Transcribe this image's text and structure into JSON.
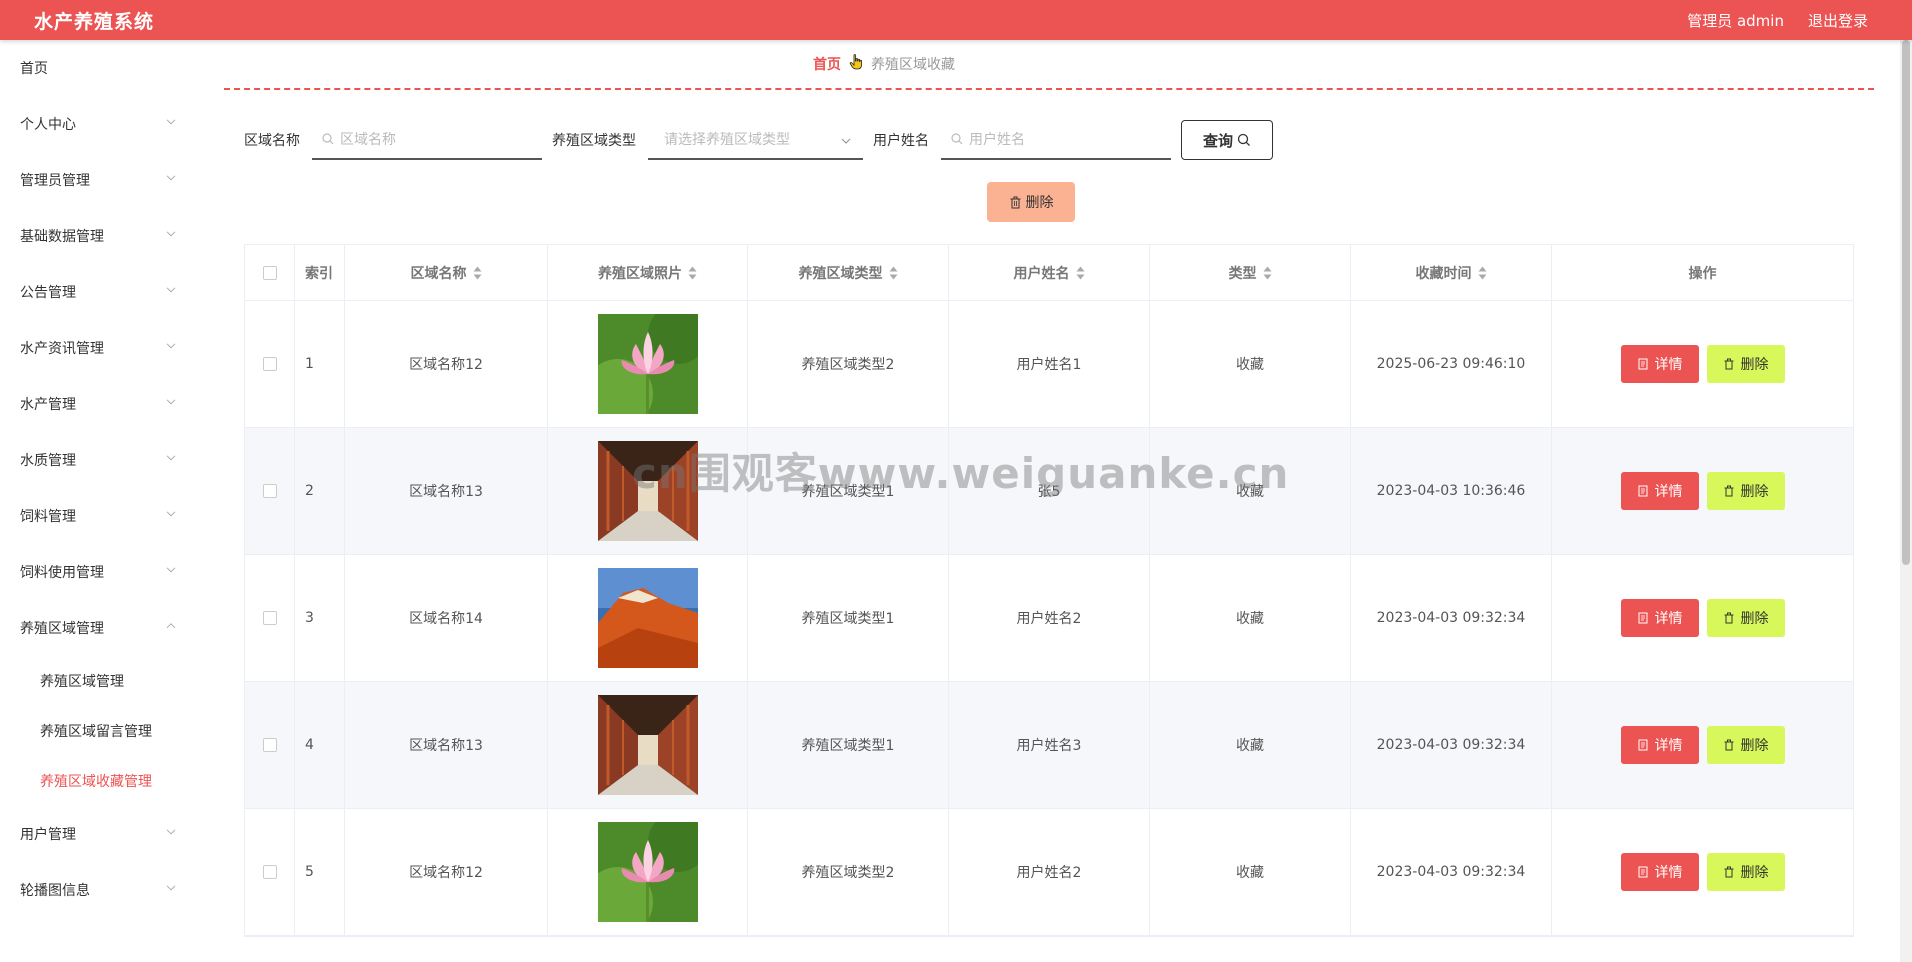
{
  "app": {
    "title": "水产养殖系统"
  },
  "header": {
    "user_label": "管理员 admin",
    "logout_label": "退出登录"
  },
  "sidebar": {
    "items": [
      {
        "label": "首页",
        "has_chevron": false
      },
      {
        "label": "个人中心",
        "has_chevron": true
      },
      {
        "label": "管理员管理",
        "has_chevron": true
      },
      {
        "label": "基础数据管理",
        "has_chevron": true
      },
      {
        "label": "公告管理",
        "has_chevron": true
      },
      {
        "label": "水产资讯管理",
        "has_chevron": true
      },
      {
        "label": "水产管理",
        "has_chevron": true
      },
      {
        "label": "水质管理",
        "has_chevron": true
      },
      {
        "label": "饲料管理",
        "has_chevron": true
      },
      {
        "label": "饲料使用管理",
        "has_chevron": true
      },
      {
        "label": "养殖区域管理",
        "has_chevron": true,
        "expanded": true
      },
      {
        "label": "用户管理",
        "has_chevron": true
      },
      {
        "label": "轮播图信息",
        "has_chevron": true
      }
    ],
    "submenu": [
      {
        "label": "养殖区域管理"
      },
      {
        "label": "养殖区域留言管理"
      },
      {
        "label": "养殖区域收藏管理",
        "active": true
      }
    ]
  },
  "breadcrumb": {
    "home": "首页",
    "current": "养殖区域收藏"
  },
  "search": {
    "area_name_label": "区域名称",
    "area_name_placeholder": "区域名称",
    "area_type_label": "养殖区域类型",
    "area_type_placeholder": "请选择养殖区域类型",
    "user_name_label": "用户姓名",
    "user_name_placeholder": "用户姓名",
    "query_label": "查询"
  },
  "bulk_delete_label": "删除",
  "table": {
    "headers": {
      "index": "索引",
      "name": "区域名称",
      "photo": "养殖区域照片",
      "type": "养殖区域类型",
      "user": "用户姓名",
      "kind": "类型",
      "time": "收藏时间",
      "ops": "操作"
    },
    "rows": [
      {
        "index": "1",
        "name": "区域名称12",
        "photo": "lotus",
        "type": "养殖区域类型2",
        "user": "用户姓名1",
        "kind": "收藏",
        "time": "2025-06-23 09:46:10"
      },
      {
        "index": "2",
        "name": "区域名称13",
        "photo": "corridor",
        "type": "养殖区域类型1",
        "user": "张5",
        "kind": "收藏",
        "time": "2023-04-03 10:36:46"
      },
      {
        "index": "3",
        "name": "区域名称14",
        "photo": "mountain",
        "type": "养殖区域类型1",
        "user": "用户姓名2",
        "kind": "收藏",
        "time": "2023-04-03 09:32:34"
      },
      {
        "index": "4",
        "name": "区域名称13",
        "photo": "corridor",
        "type": "养殖区域类型1",
        "user": "用户姓名3",
        "kind": "收藏",
        "time": "2023-04-03 09:32:34"
      },
      {
        "index": "5",
        "name": "区域名称12",
        "photo": "lotus",
        "type": "养殖区域类型2",
        "user": "用户姓名2",
        "kind": "收藏",
        "time": "2023-04-03 09:32:34"
      }
    ],
    "detail_label": "详情",
    "delete_label": "删除"
  },
  "watermark": "cn围观客www.weiguanke.cn",
  "colors": {
    "primary": "#ec5353",
    "delete_btn": "#d8f75a",
    "bulk_delete": "#fbb292"
  }
}
